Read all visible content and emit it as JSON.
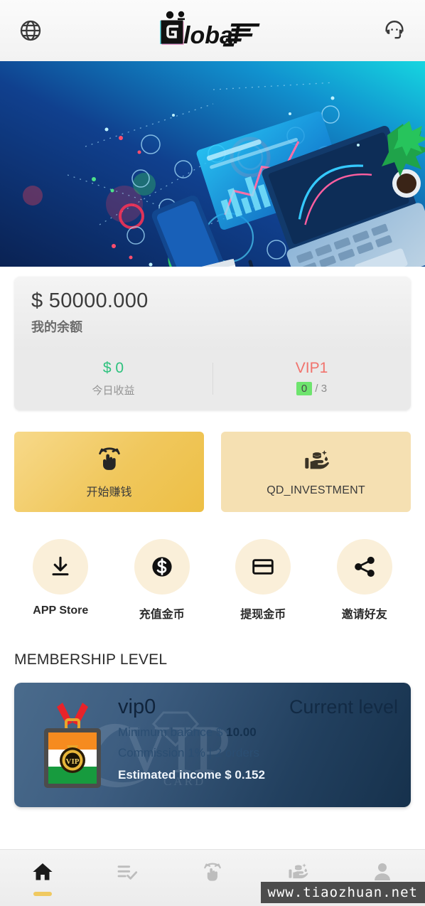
{
  "header": {
    "left_icon": "globe-icon",
    "right_icon": "headset-support-icon",
    "logo_text": "Global"
  },
  "banner": {
    "alt": "digital-workspace-illustration"
  },
  "balance": {
    "amount": "$ 50000.000",
    "label": "我的余额",
    "today_income_value": "$ 0",
    "today_income_label": "今日收益",
    "vip_level": "VIP1",
    "vip_count": "0",
    "vip_total": "/ 3"
  },
  "actions": [
    {
      "label": "开始赚钱",
      "icon": "tap-gesture-icon"
    },
    {
      "label": "QD_INVESTMENT",
      "icon": "hand-coins-icon"
    }
  ],
  "quick_actions": [
    {
      "label": "APP Store",
      "icon": "download-icon"
    },
    {
      "label": "充值金币",
      "icon": "dollar-coin-icon"
    },
    {
      "label": "提现金币",
      "icon": "credit-card-icon"
    },
    {
      "label": "邀请好友",
      "icon": "share-icon"
    }
  ],
  "membership": {
    "section_title": "MEMBERSHIP LEVEL",
    "level_name": "vip0",
    "current_tag": "Current level",
    "min_balance_label": "Minimum balance $ ",
    "min_balance_value": "10.00",
    "commission": "Commission 1% | 2 orders",
    "estimated_income": "Estimated income $ 0.152",
    "badge_icon": "vip-medal-badge-icon"
  },
  "bottom_nav": [
    {
      "icon": "home-icon",
      "active": true
    },
    {
      "icon": "task-list-check-icon",
      "active": false
    },
    {
      "icon": "tap-gesture-icon",
      "active": false
    },
    {
      "icon": "hand-coins-icon",
      "active": false
    },
    {
      "icon": "person-icon",
      "active": false
    }
  ],
  "watermark": {
    "text": "www.tiaozhuan.net"
  },
  "colors": {
    "accent_gold": "#f0c75c",
    "accent_gold_light": "#f5e0b2",
    "quick_circle": "#faefd9",
    "green": "#2ec27e",
    "vip_red": "#f1736d",
    "green_badge": "#6ee46e"
  }
}
